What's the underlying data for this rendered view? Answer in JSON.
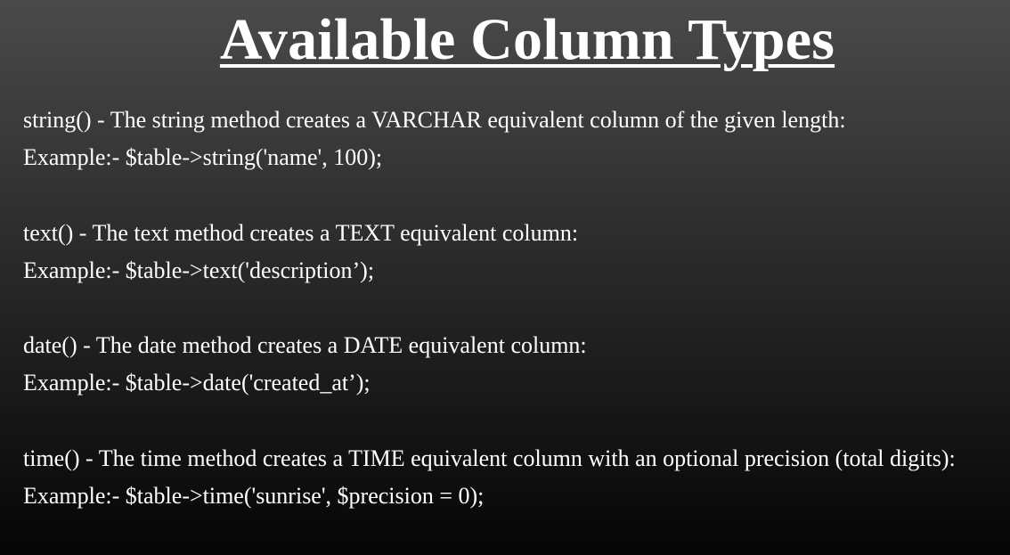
{
  "title": "Available Column Types",
  "entries": [
    {
      "description": "string() - The string method creates a VARCHAR equivalent column of the given length:",
      "example": "Example:- $table->string('name', 100);"
    },
    {
      "description": "text() - The text method creates a TEXT equivalent column:",
      "example": "Example:- $table->text('description’);"
    },
    {
      "description": "date() - The date method creates a DATE equivalent column:",
      "example": "Example:- $table->date('created_at’);"
    },
    {
      "description": "time() - The time method creates a TIME equivalent column with an optional precision (total digits):",
      "example": "Example:- $table->time('sunrise', $precision = 0);"
    }
  ]
}
